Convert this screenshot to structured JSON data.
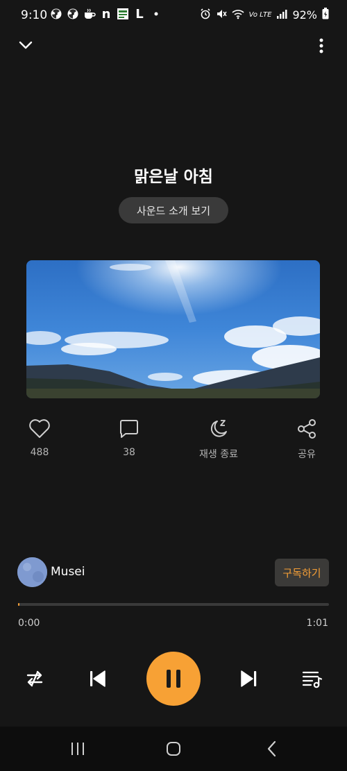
{
  "status_bar": {
    "time": "9:10",
    "battery": "92%",
    "icons_left": [
      "radiation-icon",
      "radiation-icon",
      "coffee-icon",
      "naver-icon",
      "gs-fresh-icon",
      "l-app-icon",
      "dot-icon"
    ],
    "icons_right": [
      "alarm-icon",
      "mute-icon",
      "wifi-icon",
      "volte-icon",
      "signal-icon",
      "battery-icon"
    ]
  },
  "header": {
    "collapse_icon": "chevron-down-icon",
    "more_icon": "more-vertical-icon"
  },
  "track": {
    "title": "맑은날 아침",
    "intro_button": "사운드 소개 보기"
  },
  "actions": [
    {
      "icon": "heart-icon",
      "label": "488"
    },
    {
      "icon": "comment-icon",
      "label": "38"
    },
    {
      "icon": "sleep-timer-icon",
      "label": "재생 종료"
    },
    {
      "icon": "share-icon",
      "label": "공유"
    }
  ],
  "artist": {
    "name": "Musei",
    "subscribe_label": "구독하기"
  },
  "progress": {
    "current": "0:00",
    "total": "1:01",
    "fraction": 0.005
  },
  "controls": [
    "repeat-icon",
    "previous-icon",
    "pause-icon",
    "next-icon",
    "playlist-icon"
  ],
  "colors": {
    "accent": "#f7a135",
    "background": "#161616"
  }
}
